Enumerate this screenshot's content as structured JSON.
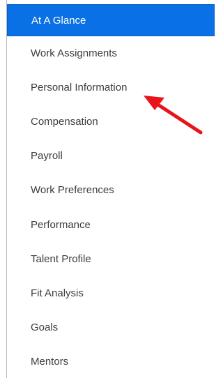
{
  "nav": {
    "items": [
      {
        "label": "At A Glance",
        "active": true
      },
      {
        "label": "Work Assignments"
      },
      {
        "label": "Personal Information"
      },
      {
        "label": "Compensation"
      },
      {
        "label": "Payroll"
      },
      {
        "label": "Work Preferences"
      },
      {
        "label": "Performance"
      },
      {
        "label": "Talent Profile"
      },
      {
        "label": "Fit Analysis"
      },
      {
        "label": "Goals"
      },
      {
        "label": "Mentors"
      }
    ]
  },
  "colors": {
    "active_bg": "#0a70e6",
    "text": "#3d3d3d",
    "arrow": "#e8141a"
  },
  "annotation": {
    "icon": "red-arrow-icon",
    "points_to": "Personal Information"
  }
}
